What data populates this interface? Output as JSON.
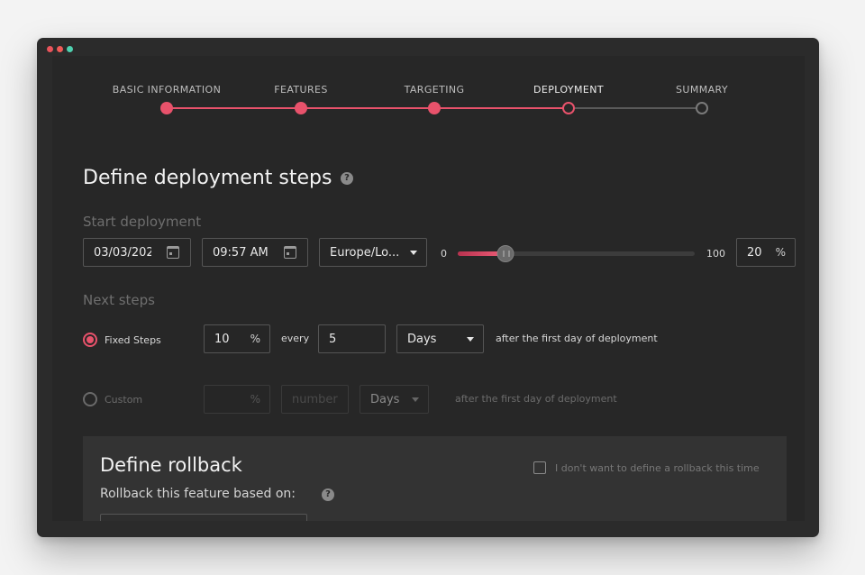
{
  "stepper": {
    "steps": [
      {
        "label": "BASIC INFORMATION",
        "state": "done"
      },
      {
        "label": "FEATURES",
        "state": "done"
      },
      {
        "label": "TARGETING",
        "state": "done"
      },
      {
        "label": "DEPLOYMENT",
        "state": "current"
      },
      {
        "label": "SUMMARY",
        "state": "todo"
      }
    ]
  },
  "page": {
    "title": "Define deployment steps",
    "help_glyph": "?"
  },
  "start": {
    "label": "Start deployment",
    "date": "03/03/202",
    "time": "09:57 AM",
    "timezone": "Europe/Lo...",
    "slider_min": "0",
    "slider_max": "100",
    "slider_value": 20,
    "percent_value": "20",
    "percent_unit": "%"
  },
  "next": {
    "label": "Next steps",
    "fixed": {
      "label": "Fixed Steps",
      "selected": true,
      "percent": "10",
      "percent_unit": "%",
      "every_label": "every",
      "every_value": "5",
      "unit": "Days",
      "suffix": "after the first day of deployment"
    },
    "custom": {
      "label": "Custom",
      "selected": false,
      "percent_unit": "%",
      "number_placeholder": "number",
      "unit": "Days",
      "suffix": "after the first day of deployment"
    }
  },
  "rollback": {
    "title": "Define rollback",
    "subtitle": "Rollback this feature based on:",
    "help_glyph": "?",
    "checkbox_label": "I don't want to define a rollback this time",
    "checkbox_checked": false
  },
  "colors": {
    "accent": "#e8526b",
    "background": "#272727",
    "window": "#2b2b2b"
  }
}
